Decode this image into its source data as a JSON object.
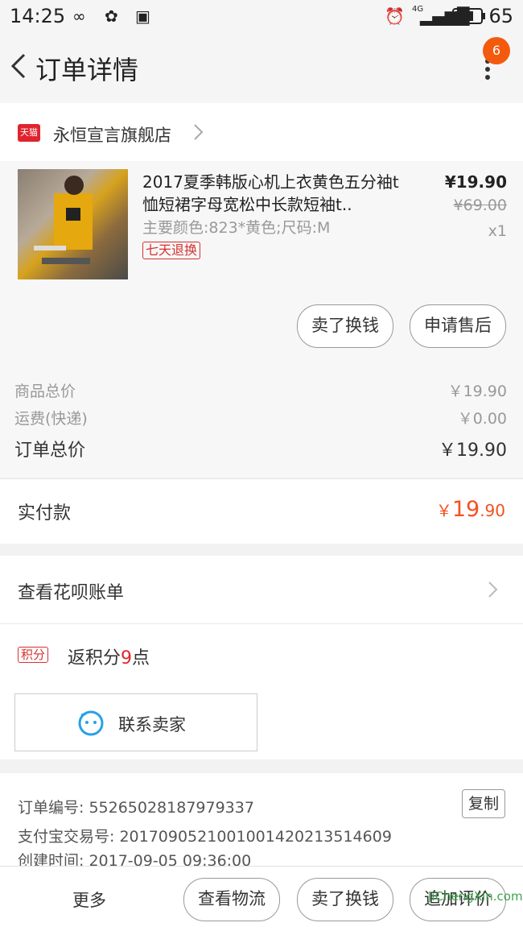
{
  "status_bar": {
    "time": "14:25",
    "battery": "65",
    "network": "4G"
  },
  "nav": {
    "title": "订单详情",
    "badge": "6"
  },
  "store": {
    "name": "永恒宣言旗舰店",
    "brand_tag": "天猫"
  },
  "product": {
    "title": "2017夏季韩版心机上衣黄色五分袖t恤短裙字母宽松中长款短袖t..",
    "spec": "主要颜色:823*黄色;尺码:M",
    "tag": "七天退换",
    "price": "¥19.90",
    "original_price": "¥69.00",
    "quantity": "x1",
    "buttons": {
      "sell": "卖了换钱",
      "aftersale": "申请售后"
    }
  },
  "totals": {
    "goods_label": "商品总价",
    "goods_value": "￥19.90",
    "shipping_label": "运费(快递)",
    "shipping_value": "￥0.00",
    "order_label": "订单总价",
    "order_value": "￥19.90",
    "paid_label": "实付款",
    "paid_currency": "￥",
    "paid_int": "19",
    "paid_dec": ".90"
  },
  "huabei": {
    "label": "查看花呗账单"
  },
  "points": {
    "tag": "积分",
    "prefix": "返积分",
    "num": "9",
    "suffix": "点"
  },
  "contact": {
    "label": "联系卖家"
  },
  "order_info": {
    "order_no": "订单编号: 55265028187979337",
    "alipay_no": "支付宝交易号: 2017090521001001420213514609",
    "created": "创建时间: 2017-09-05 09:36:00",
    "copy_label": "复制"
  },
  "bottom_bar": {
    "more": "更多",
    "logistics": "查看物流",
    "sell": "卖了换钱",
    "review": "追加评价"
  },
  "watermark": "JiChengXin.com",
  "colors": {
    "accent": "#f4511e",
    "tmall_red": "#e0242f",
    "badge": "#f45a0e"
  }
}
